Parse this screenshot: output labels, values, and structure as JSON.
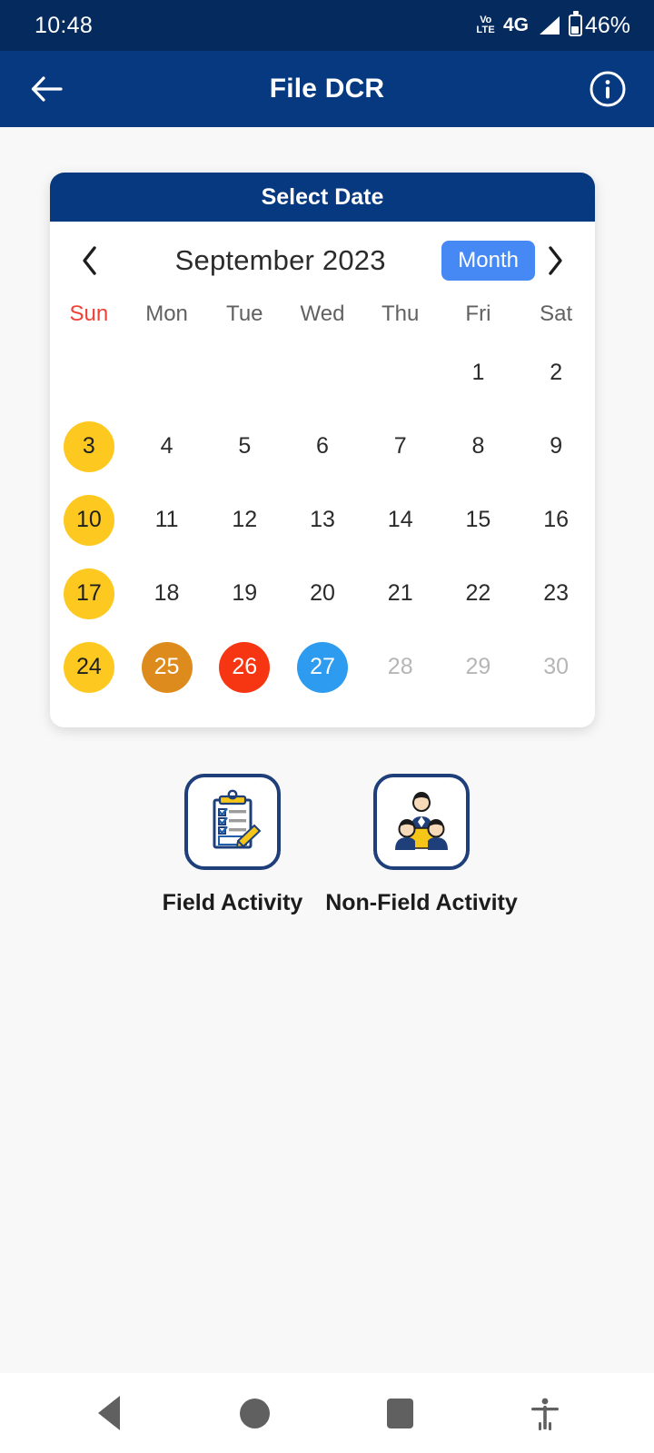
{
  "status_bar": {
    "time": "10:48",
    "volte_top": "Vo",
    "volte_bottom": "LTE",
    "network": "4G",
    "battery_percent": "46%",
    "icons": [
      "volte-icon",
      "signal-bars-icon",
      "battery-icon"
    ]
  },
  "app_bar": {
    "title": "File DCR",
    "back_icon": "back-arrow-icon",
    "info_icon": "info-circle-icon"
  },
  "calendar": {
    "card_title": "Select Date",
    "month_label": "September 2023",
    "view_button": "Month",
    "prev_icon": "chevron-left-icon",
    "next_icon": "chevron-right-icon",
    "weekdays": [
      "Sun",
      "Mon",
      "Tue",
      "Wed",
      "Thu",
      "Fri",
      "Sat"
    ],
    "weeks": [
      [
        {
          "day": "",
          "state": "empty"
        },
        {
          "day": "",
          "state": "empty"
        },
        {
          "day": "",
          "state": "empty"
        },
        {
          "day": "",
          "state": "empty"
        },
        {
          "day": "",
          "state": "empty"
        },
        {
          "day": "1",
          "state": "normal"
        },
        {
          "day": "2",
          "state": "normal"
        }
      ],
      [
        {
          "day": "3",
          "state": "yellow"
        },
        {
          "day": "4",
          "state": "normal"
        },
        {
          "day": "5",
          "state": "normal"
        },
        {
          "day": "6",
          "state": "normal"
        },
        {
          "day": "7",
          "state": "normal"
        },
        {
          "day": "8",
          "state": "normal"
        },
        {
          "day": "9",
          "state": "normal"
        }
      ],
      [
        {
          "day": "10",
          "state": "yellow"
        },
        {
          "day": "11",
          "state": "normal"
        },
        {
          "day": "12",
          "state": "normal"
        },
        {
          "day": "13",
          "state": "normal"
        },
        {
          "day": "14",
          "state": "normal"
        },
        {
          "day": "15",
          "state": "normal"
        },
        {
          "day": "16",
          "state": "normal"
        }
      ],
      [
        {
          "day": "17",
          "state": "yellow"
        },
        {
          "day": "18",
          "state": "normal"
        },
        {
          "day": "19",
          "state": "normal"
        },
        {
          "day": "20",
          "state": "normal"
        },
        {
          "day": "21",
          "state": "normal"
        },
        {
          "day": "22",
          "state": "normal"
        },
        {
          "day": "23",
          "state": "normal"
        }
      ],
      [
        {
          "day": "24",
          "state": "yellow"
        },
        {
          "day": "25",
          "state": "orange"
        },
        {
          "day": "26",
          "state": "red"
        },
        {
          "day": "27",
          "state": "blue"
        },
        {
          "day": "28",
          "state": "dim"
        },
        {
          "day": "29",
          "state": "dim"
        },
        {
          "day": "30",
          "state": "dim"
        }
      ]
    ]
  },
  "activities": [
    {
      "label": "Field Activity",
      "icon": "clipboard-checklist-pencil-icon"
    },
    {
      "label": "Non-Field Activity",
      "icon": "group-people-meeting-icon"
    }
  ],
  "nav_bar": {
    "items": [
      "back-triangle-icon",
      "home-circle-icon",
      "recents-square-icon",
      "accessibility-icon"
    ]
  },
  "colors": {
    "status_bar_bg": "#052a5e",
    "app_bar_bg": "#06397f",
    "page_bg": "#f8f8f8",
    "month_button": "#4789f4",
    "sunday_label": "#ef4136",
    "day_yellow": "#fdc921",
    "day_orange": "#de8b1d",
    "day_red": "#f63612",
    "day_blue": "#2d9bf0",
    "icon_border": "#1f3f7a"
  }
}
